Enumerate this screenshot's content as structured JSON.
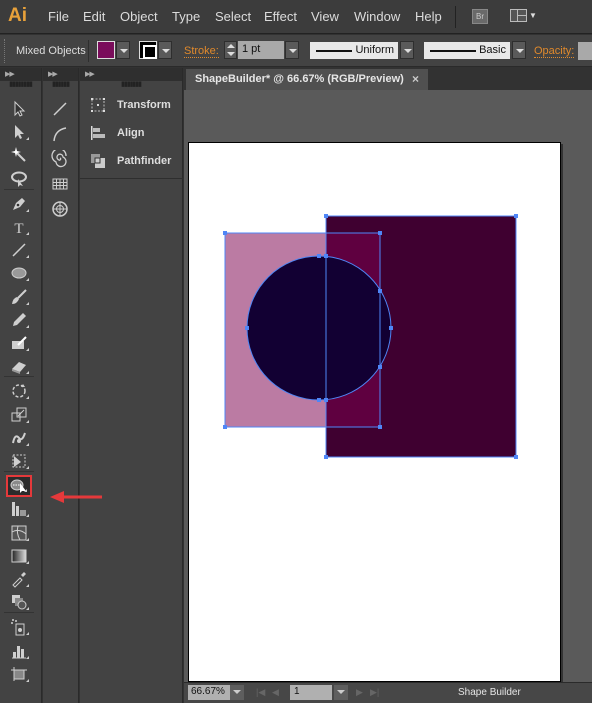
{
  "app": {
    "logo": "Ai",
    "menu": [
      "File",
      "Edit",
      "Object",
      "Type",
      "Select",
      "Effect",
      "View",
      "Window",
      "Help"
    ],
    "bridge_button": "Br",
    "workspace_icon": "workspace-switcher-icon"
  },
  "control_bar": {
    "selection_label": "Mixed Objects",
    "fill_color": "#7a0d5b",
    "stroke_label": "Stroke:",
    "stroke_weight": "1 pt",
    "variable_width_profile": "Uniform",
    "brush_definition": "Basic",
    "opacity_label": "Opacity:"
  },
  "tools_panel": {
    "column1": [
      {
        "name": "selection-tool",
        "icon": "arrow-icon"
      },
      {
        "name": "direct-selection-tool",
        "icon": "white-arrow-icon"
      },
      {
        "name": "magic-wand-tool",
        "icon": "magic-wand-icon"
      },
      {
        "name": "lasso-tool",
        "icon": "lasso-icon"
      },
      {
        "name": "pen-tool",
        "icon": "pen-icon"
      },
      {
        "name": "type-tool",
        "icon": "type-icon"
      },
      {
        "name": "line-segment-tool",
        "icon": "line-icon"
      },
      {
        "name": "ellipse-tool",
        "icon": "ellipse-icon"
      },
      {
        "name": "paintbrush-tool",
        "icon": "brush-icon"
      },
      {
        "name": "pencil-tool",
        "icon": "pencil-icon"
      },
      {
        "name": "blob-brush-tool",
        "icon": "blob-brush-icon"
      },
      {
        "name": "eraser-tool",
        "icon": "eraser-icon"
      },
      {
        "name": "rotate-tool",
        "icon": "rotate-icon"
      },
      {
        "name": "scale-tool",
        "icon": "scale-icon"
      },
      {
        "name": "warp-tool",
        "icon": "warp-icon"
      },
      {
        "name": "free-transform-tool",
        "icon": "free-transform-icon"
      },
      {
        "name": "shape-builder-tool",
        "icon": "shape-builder-icon",
        "active": true
      },
      {
        "name": "perspective-grid-tool",
        "icon": "perspective-grid-icon"
      },
      {
        "name": "mesh-tool",
        "icon": "mesh-icon"
      },
      {
        "name": "gradient-tool",
        "icon": "gradient-icon"
      },
      {
        "name": "eyedropper-tool",
        "icon": "eyedropper-icon"
      },
      {
        "name": "blend-tool",
        "icon": "blend-icon"
      },
      {
        "name": "symbol-sprayer-tool",
        "icon": "symbol-sprayer-icon"
      },
      {
        "name": "column-graph-tool",
        "icon": "graph-icon"
      },
      {
        "name": "artboard-tool",
        "icon": "artboard-icon"
      }
    ],
    "column2": [
      {
        "name": "line-segment-tool",
        "icon": "line-icon"
      },
      {
        "name": "arc-tool",
        "icon": "arc-icon"
      },
      {
        "name": "spiral-tool",
        "icon": "spiral-icon"
      },
      {
        "name": "rectangular-grid-tool",
        "icon": "grid-icon"
      },
      {
        "name": "polar-grid-tool",
        "icon": "polar-grid-icon"
      }
    ]
  },
  "panels": [
    {
      "label": "Transform",
      "icon": "transform-icon"
    },
    {
      "label": "Align",
      "icon": "align-icon"
    },
    {
      "label": "Pathfinder",
      "icon": "pathfinder-icon"
    }
  ],
  "document": {
    "tab_title": "ShapeBuilder* @ 66.67% (RGB/Preview)",
    "close": "×",
    "shapes": {
      "left_rect_fill": "#bb7ba3",
      "right_rect_fill": "#3f0030",
      "overlap_fill": "#5f0040",
      "circle_fill": "#120033",
      "selection_color": "#4f86f7"
    }
  },
  "status_bar": {
    "zoom": "66.67%",
    "artboard_number": "1",
    "current_tool": "Shape Builder"
  },
  "annotation": {
    "arrow_color": "#e5393b"
  }
}
